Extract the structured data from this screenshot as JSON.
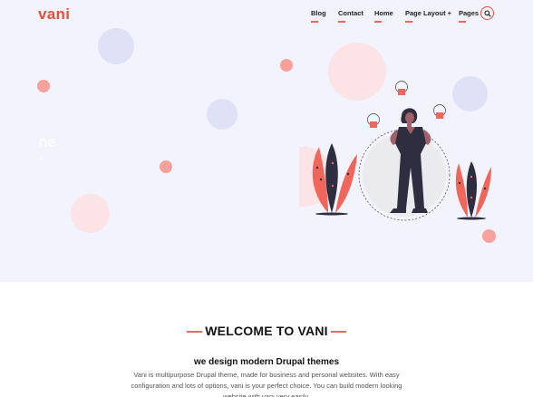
{
  "header": {
    "logo": "vani",
    "nav": [
      {
        "label": "Blog"
      },
      {
        "label": "Contact"
      },
      {
        "label": "Home"
      },
      {
        "label": "Page Layout +"
      },
      {
        "label": "Pages"
      }
    ],
    "search_icon": "search-icon"
  },
  "hero": {
    "faded_heading": "ne"
  },
  "welcome": {
    "title": "WELCOME TO VANI",
    "subtitle": "we design modern Drupal themes",
    "description": "Vani is multipurpose Drupal theme, made for business and personal websites. With easy configuration and lots of options, vani is your perfect choice. You can build modern looking website with vani very easily."
  },
  "colors": {
    "accent": "#e8503a",
    "hero_bg": "#f2f3fd",
    "figure": "#2f2e41",
    "skin": "#a0616a"
  }
}
